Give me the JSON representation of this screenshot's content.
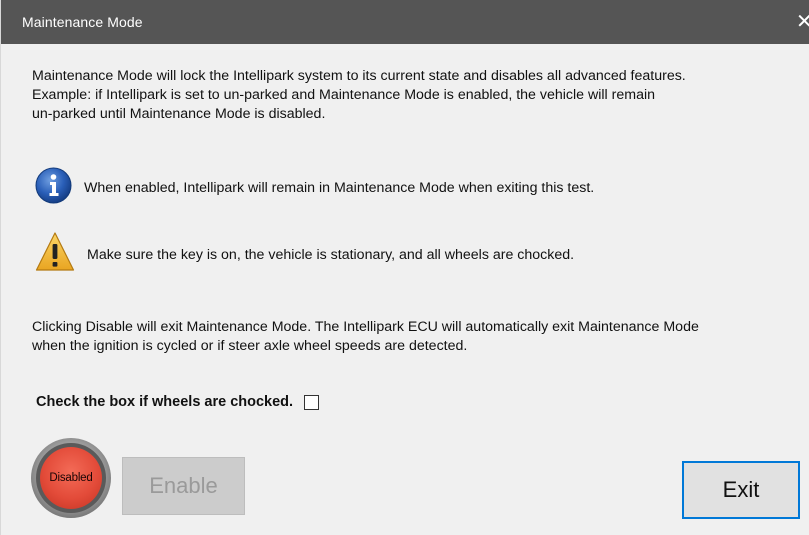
{
  "window": {
    "title": "Maintenance Mode",
    "close_glyph": "✕"
  },
  "description": {
    "line1": "Maintenance Mode will lock the Intellipark system to its current state and disables all advanced features.",
    "line2": "Example: if Intellipark is set to un-parked and Maintenance Mode is enabled, the vehicle will remain",
    "line3": "un-parked until Maintenance Mode is disabled."
  },
  "info_note": {
    "icon": "info-icon",
    "text": "When enabled, Intellipark will remain in Maintenance Mode when exiting this test."
  },
  "warning_note": {
    "icon": "warning-icon",
    "text": "Make sure the key is on, the vehicle is stationary, and all wheels are chocked."
  },
  "ecu_note": {
    "line1": "Clicking Disable will exit Maintenance Mode. The Intellipark ECU will automatically exit Maintenance Mode",
    "line2": "when the ignition is cycled or if steer axle wheel speeds are detected."
  },
  "chock_check": {
    "label": "Check the box if wheels are chocked.",
    "checked": false
  },
  "status_indicator": {
    "label": "Disabled",
    "color": "#e34b39"
  },
  "buttons": {
    "enable_label": "Enable",
    "enable_disabled": true,
    "exit_label": "Exit"
  },
  "colors": {
    "titlebar": "#555555",
    "background": "#f0f0f0",
    "accent": "#0078d7"
  }
}
